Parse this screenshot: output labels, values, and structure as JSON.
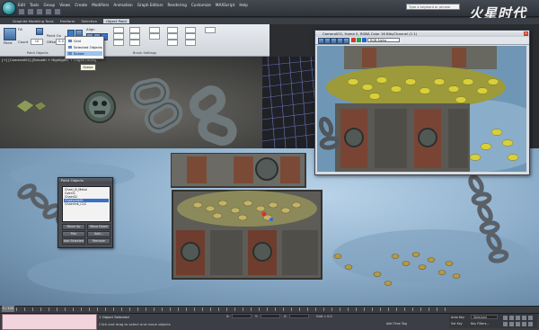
{
  "titlebar": {
    "menu_items": [
      "Edit",
      "Tools",
      "Group",
      "Views",
      "Create",
      "Modifiers",
      "Animation",
      "Graph Editors",
      "Rendering",
      "Customize",
      "MAXScript",
      "Help"
    ],
    "search_placeholder": "Type a keyword or phrase"
  },
  "watermark": {
    "title": "火星时代",
    "url": "www.hxsd.com"
  },
  "ribbon": {
    "tabs": [
      "Graphite Modeling Tools",
      "Freeform",
      "Selection",
      "Object Paint"
    ],
    "active_tab": "Object Paint",
    "fill_label": "Fill",
    "paint_label": "Paint",
    "count_label": "Count",
    "count_value": "10",
    "offset_label": "Offset",
    "offset_value": "0.0",
    "align_label": "Align",
    "paint_on_label": "Paint On",
    "group_paint_objects": "Paint Objects",
    "group_brush_settings": "Brush Settings"
  },
  "dropdown": {
    "items": [
      "Grid",
      "Selected Objects",
      "Scene"
    ],
    "selected": "Scene"
  },
  "tooltip": {
    "text": "Scene"
  },
  "viewport_top": {
    "label": "[+] [Camera001] [Smooth + Highlights + Edged Faces]"
  },
  "frame_buffer": {
    "title": "Camera001, frame 0, RGBA Color 16 Bits/Channel (1:1)",
    "channel": "RGB Alpha"
  },
  "paint_dialog": {
    "title": "Paint Objects",
    "items": [
      "Chain_B_Metal",
      "Coin01",
      "Chain02",
      "ChainLink01",
      "Chainlink_CLS"
    ],
    "selected_index": 3,
    "buttons": [
      "Move Up",
      "Move Down",
      "Pick",
      "Add...",
      "Add Selected",
      "Remove"
    ]
  },
  "statusbar": {
    "frame": "0 / 100",
    "selected": "1 Object Selected",
    "prompt": "Click and drag to select and move objects",
    "x_label": "X:",
    "y_label": "Y:",
    "z_label": "Z:",
    "grid_label": "Grid = 0.0",
    "auto_key": "Auto Key",
    "set_key": "Set Key",
    "selected_dropdown": "Selected",
    "key_filters": "Key Filters...",
    "add_time_tag": "Add Time Tag"
  },
  "colors": {
    "accent": "#3870c8",
    "ribbon_bg": "#dfe3e8",
    "titlebar_bg": "#3a3e45"
  }
}
